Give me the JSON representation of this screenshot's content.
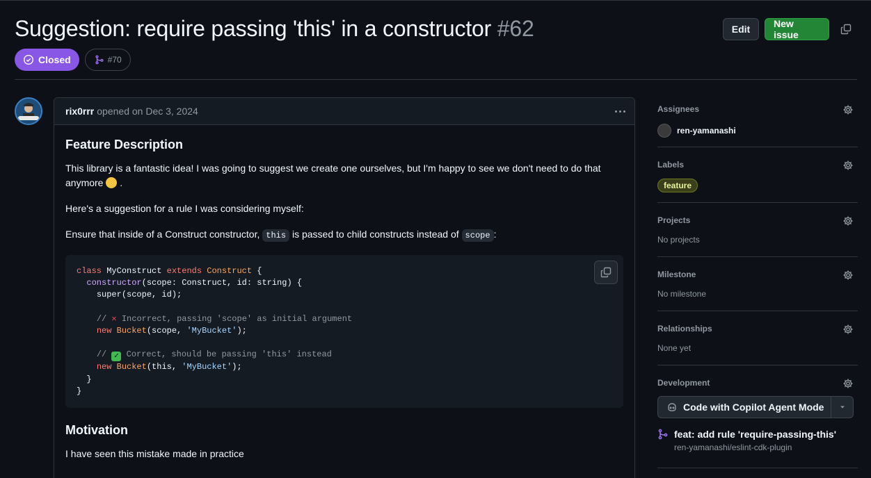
{
  "issue": {
    "title": "Suggestion: require passing 'this' in a constructor",
    "number": "#62",
    "state": "Closed",
    "linked_pr": "#70"
  },
  "header_actions": {
    "edit_label": "Edit",
    "new_issue_label": "New issue"
  },
  "comment": {
    "author": "rix0rrr",
    "meta": "opened on Dec 3, 2024",
    "heading_feature": "Feature Description",
    "para1": "This library is a fantastic idea! I was going to suggest we create one ourselves, but I'm happy to see we don't need to do that anymore",
    "para1_end": ".",
    "para2": "Here's a suggestion for a rule I was considering myself:",
    "para3_pre": "Ensure that inside of a Construct constructor,",
    "para3_code1": "this",
    "para3_mid": "is passed to child constructs instead of",
    "para3_code2": "scope",
    "para3_end": ":",
    "heading_motivation": "Motivation",
    "para4": "I have seen this mistake made in practice"
  },
  "code": {
    "l1_kw_class": "class",
    "l1_name": "MyConstruct",
    "l1_kw_extends": "extends",
    "l1_base": "Construct",
    "l1_brace": "{",
    "l2_fn": "constructor",
    "l2_rest": "(scope: Construct, id: string) {",
    "l3": "super(scope, id);",
    "l5_slash": "//",
    "l5_text": "Incorrect, passing 'scope' as initial argument",
    "l6_new": "new",
    "l6_cls": "Bucket",
    "l6_args_pre": "(scope,",
    "l6_str": "'MyBucket'",
    "l6_args_post": ");",
    "l8_slash": "//",
    "l8_text": "Correct, should be passing 'this' instead",
    "l9_new": "new",
    "l9_cls": "Bucket",
    "l9_args_pre": "(this,",
    "l9_str": "'MyBucket'",
    "l9_args_post": ");",
    "l10": "}",
    "l11": "}"
  },
  "sidebar": {
    "assignees_title": "Assignees",
    "assignee_name": "ren-yamanashi",
    "labels_title": "Labels",
    "label_feature": "feature",
    "projects_title": "Projects",
    "projects_value": "No projects",
    "milestone_title": "Milestone",
    "milestone_value": "No milestone",
    "relationships_title": "Relationships",
    "relationships_value": "None yet",
    "development_title": "Development",
    "copilot_label": "Code with Copilot Agent Mode",
    "branch_title": "feat: add rule 'require-passing-this'",
    "branch_repo": "ren-yamanashi/eslint-cdk-plugin"
  },
  "colors": {
    "closed_badge": "#8957e5",
    "new_issue_button": "#238636",
    "label_feature_bg": "#3b3f1a"
  }
}
